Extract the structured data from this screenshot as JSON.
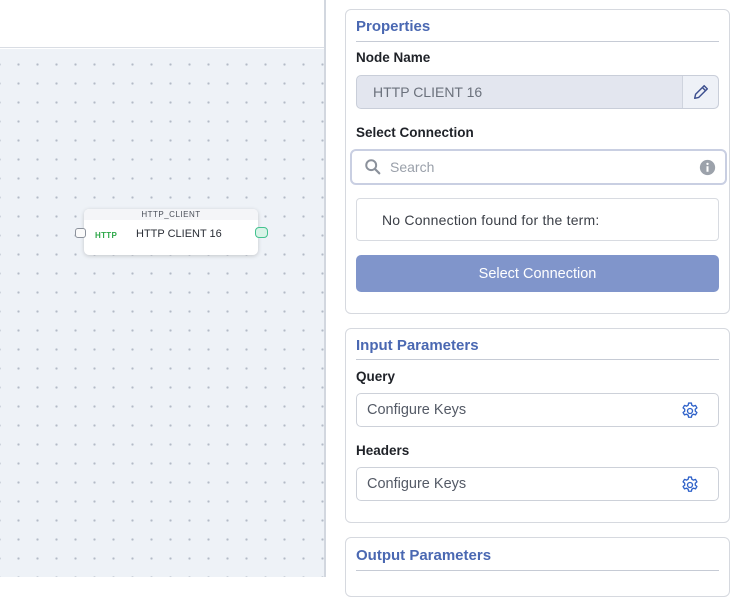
{
  "canvas": {
    "node": {
      "type_label": "HTTP_CLIENT",
      "badge": "HTTP",
      "label": "HTTP CLIENT 16"
    }
  },
  "properties": {
    "title": "Properties",
    "node_name_label": "Node Name",
    "node_name_value": "HTTP CLIENT 16",
    "select_connection_label": "Select Connection",
    "search_placeholder": "Search",
    "empty_message": "No Connection found for the term:",
    "select_connection_button": "Select Connection"
  },
  "input_parameters": {
    "title": "Input Parameters",
    "query_label": "Query",
    "query_value": "Configure Keys",
    "headers_label": "Headers",
    "headers_value": "Configure Keys"
  },
  "output_parameters": {
    "title": "Output Parameters"
  },
  "icons": {
    "edit": "pencil-icon",
    "search": "search-icon",
    "info": "info-icon",
    "gear": "gear-icon"
  },
  "colors": {
    "accent": "#4a68b2",
    "button": "#8095cb",
    "http_badge": "#2fa84a",
    "output_port": "#43c28f"
  }
}
